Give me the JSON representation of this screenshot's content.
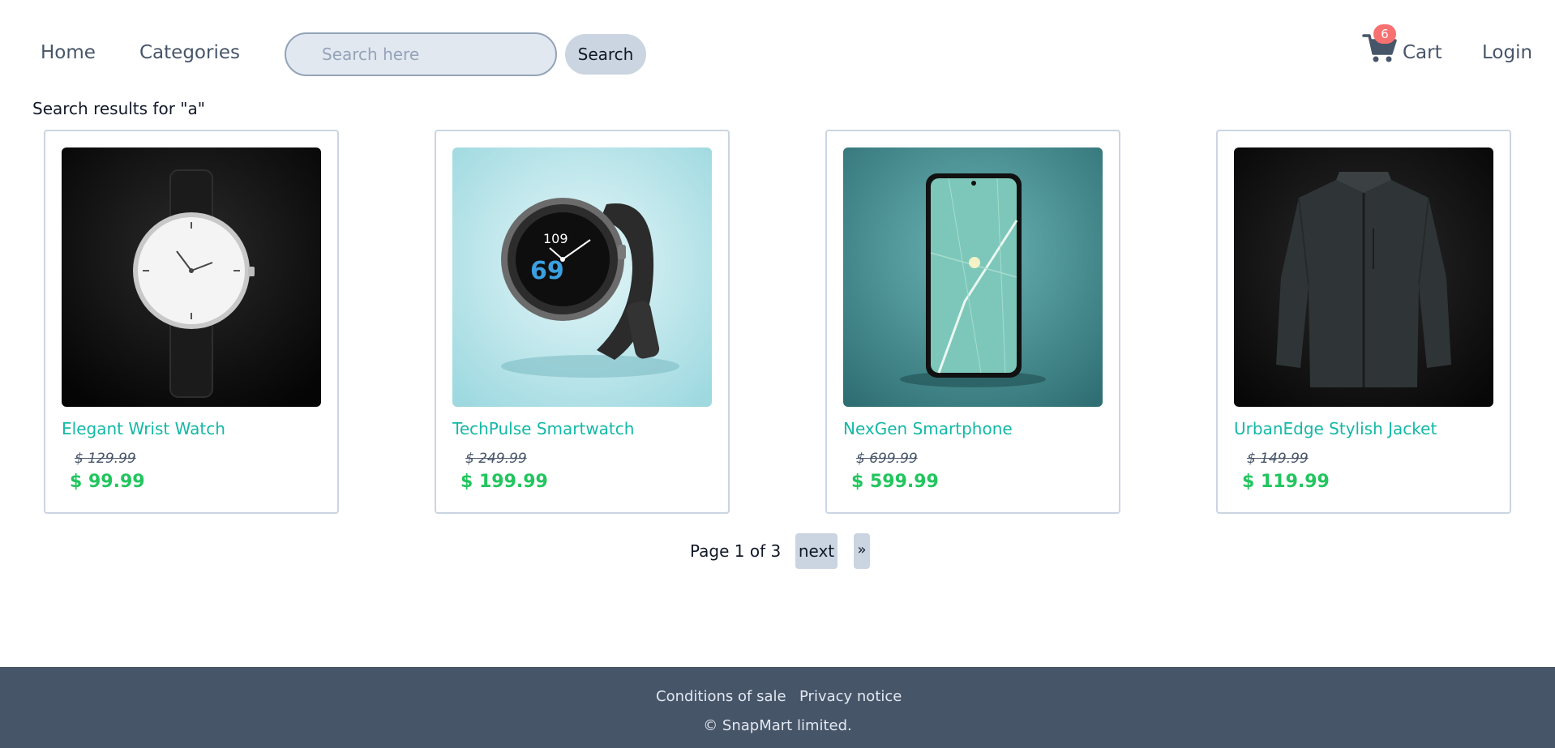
{
  "header": {
    "nav_home": "Home",
    "nav_categories": "Categories",
    "search_placeholder": "Search here",
    "search_button": "Search",
    "cart_count": "6",
    "cart_label": "Cart",
    "login_label": "Login"
  },
  "results": {
    "title": "Search results for \"a\""
  },
  "products": [
    {
      "name": "Elegant Wrist Watch",
      "old_price": "$ 129.99",
      "price": "$ 99.99",
      "image": "classic-wristwatch"
    },
    {
      "name": "TechPulse Smartwatch",
      "old_price": "$ 249.99",
      "price": "$ 199.99",
      "image": "smartwatch"
    },
    {
      "name": "NexGen Smartphone",
      "old_price": "$ 699.99",
      "price": "$ 599.99",
      "image": "smartphone"
    },
    {
      "name": "UrbanEdge Stylish Jacket",
      "old_price": "$ 149.99",
      "price": "$ 119.99",
      "image": "jacket"
    }
  ],
  "pagination": {
    "info": "Page 1 of 3",
    "next": "next",
    "last": "»"
  },
  "footer": {
    "conditions": "Conditions of sale",
    "privacy": "Privacy notice",
    "copyright": "© SnapMart limited."
  },
  "colors": {
    "accent_name": "#14b8a6",
    "price_green": "#22c55e",
    "footer_bg": "#475569",
    "badge": "#f87171"
  }
}
